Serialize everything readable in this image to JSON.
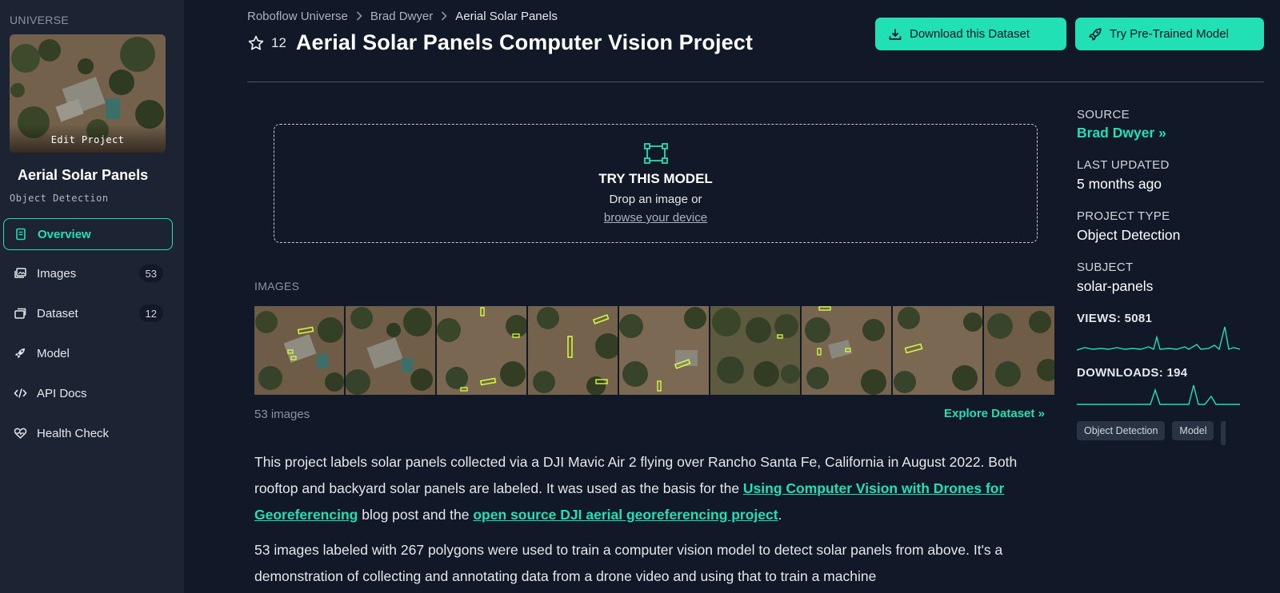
{
  "sidebar": {
    "section_label": "UNIVERSE",
    "thumbnail_label": "Edit Project",
    "project_name": "Aerial Solar Panels",
    "project_type": "Object Detection",
    "nav": [
      {
        "label": "Overview",
        "icon": "document-icon",
        "badge": null
      },
      {
        "label": "Images",
        "icon": "images-icon",
        "badge": "53"
      },
      {
        "label": "Dataset",
        "icon": "dataset-icon",
        "badge": "12"
      },
      {
        "label": "Model",
        "icon": "rocket-icon",
        "badge": null
      },
      {
        "label": "API Docs",
        "icon": "code-icon",
        "badge": null
      },
      {
        "label": "Health Check",
        "icon": "heart-pulse-icon",
        "badge": null
      }
    ]
  },
  "header": {
    "breadcrumb": [
      "Roboflow Universe",
      "Brad Dwyer",
      "Aerial Solar Panels"
    ],
    "star_count": "12",
    "title": "Aerial Solar Panels Computer Vision Project",
    "download_label": "Download this Dataset",
    "try_label": "Try Pre-Trained Model"
  },
  "try_model": {
    "title": "TRY THIS MODEL",
    "line": "Drop an image or",
    "link": "browse your device"
  },
  "images": {
    "label": "IMAGES",
    "count_label": "53 images",
    "explore_label": "Explore Dataset"
  },
  "description": {
    "p1_a": "This project labels solar panels collected via a DJI Mavic Air 2 flying over Rancho Santa Fe, California in August 2022. Both rooftop and backyard solar panels are labeled. It was used as the basis for the ",
    "p1_link1": "Using Computer Vision with Drones for Georeferencing",
    "p1_b": " blog post and the ",
    "p1_link2": "open source DJI aerial georeferencing project",
    "p1_c": ".",
    "p2": "53 images labeled with 267 polygons were used to train a computer vision model to detect solar panels from above. It's a demonstration of collecting and annotating data from a drone video and using that to train a machine"
  },
  "meta": {
    "source_label": "SOURCE",
    "source_value": "Brad Dwyer",
    "updated_label": "LAST UPDATED",
    "updated_value": "5 months ago",
    "type_label": "PROJECT TYPE",
    "type_value": "Object Detection",
    "subject_label": "SUBJECT",
    "subject_value": "solar-panels",
    "views_label": "VIEWS: 5081",
    "downloads_label": "DOWNLOADS: 194",
    "tags": [
      "Object Detection",
      "Model"
    ]
  },
  "colors": {
    "accent": "#21e0b5",
    "background": "#111827",
    "sidebar": "#1c2433"
  }
}
